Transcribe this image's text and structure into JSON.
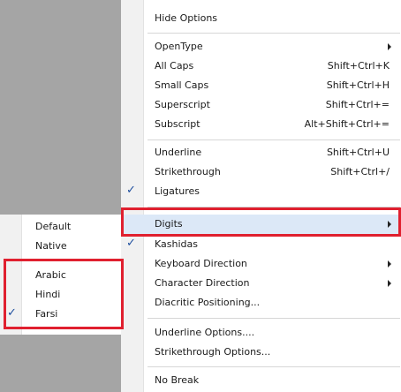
{
  "menu": {
    "items": [
      {
        "label": "Hide Options"
      },
      {
        "label": "OpenType"
      },
      {
        "label": "All Caps",
        "shortcut": "Shift+Ctrl+K"
      },
      {
        "label": "Small Caps",
        "shortcut": "Shift+Ctrl+H"
      },
      {
        "label": "Superscript",
        "shortcut": "Shift+Ctrl+="
      },
      {
        "label": "Subscript",
        "shortcut": "Alt+Shift+Ctrl+="
      },
      {
        "label": "Underline",
        "shortcut": "Shift+Ctrl+U"
      },
      {
        "label": "Strikethrough",
        "shortcut": "Shift+Ctrl+/"
      },
      {
        "label": "Ligatures",
        "checked": true
      },
      {
        "label": "Digits"
      },
      {
        "label": "Kashidas",
        "checked": true
      },
      {
        "label": "Keyboard Direction"
      },
      {
        "label": "Character Direction"
      },
      {
        "label": "Diacritic Positioning..."
      },
      {
        "label": "Underline Options...."
      },
      {
        "label": "Strikethrough Options..."
      },
      {
        "label": "No Break"
      }
    ],
    "check_glyph": "✓"
  },
  "submenu": {
    "items": [
      {
        "label": "Default"
      },
      {
        "label": "Native"
      },
      {
        "label": "Arabic"
      },
      {
        "label": "Hindi"
      },
      {
        "label": "Farsi",
        "checked": true
      }
    ]
  },
  "colors": {
    "highlight_box": "#e0202f",
    "background_gray": "#a5a5a5",
    "hover": "#dce8f7"
  }
}
